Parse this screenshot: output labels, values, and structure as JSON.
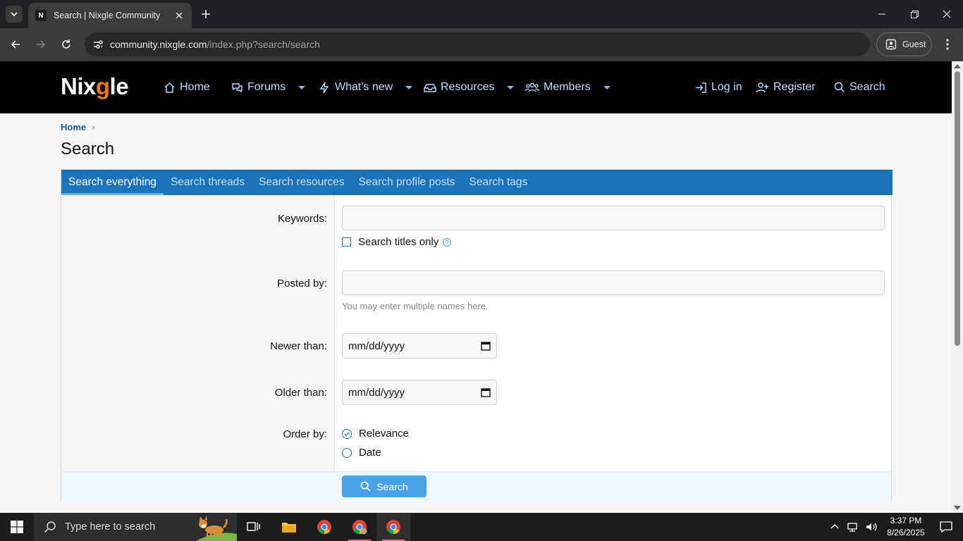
{
  "browser": {
    "tab_title": "Search | Nixgle Community",
    "favicon_letter": "N",
    "url_host": "community.nixgle.com",
    "url_path": "/index.php?search/search",
    "profile_label": "Guest"
  },
  "site": {
    "logo_main": "Nix",
    "logo_accent": "g",
    "logo_end": "le",
    "nav": {
      "home": "Home",
      "forums": "Forums",
      "whats_new": "What's new",
      "resources": "Resources",
      "members": "Members",
      "login": "Log in",
      "register": "Register",
      "search": "Search"
    }
  },
  "breadcrumb": {
    "home": "Home"
  },
  "page_title": "Search",
  "tabs": {
    "everything": "Search everything",
    "threads": "Search threads",
    "resources": "Search resources",
    "profile_posts": "Search profile posts",
    "tags": "Search tags"
  },
  "form": {
    "keywords_label": "Keywords:",
    "keywords_value": "",
    "titles_only_label": "Search titles only",
    "posted_by_label": "Posted by:",
    "posted_by_value": "",
    "posted_by_hint": "You may enter multiple names here.",
    "newer_than_label": "Newer than:",
    "newer_than_value": "mm/dd/yyyy",
    "older_than_label": "Older than:",
    "older_than_value": "mm/dd/yyyy",
    "order_by_label": "Order by:",
    "order_relevance": "Relevance",
    "order_date": "Date",
    "order_selected": "Relevance",
    "submit_label": "Search"
  },
  "taskbar": {
    "search_placeholder": "Type here to search",
    "time": "3:37 PM",
    "date": "8/26/2025"
  },
  "colors": {
    "header_bg": "#000000",
    "tabbar_bg": "#1a73b8",
    "accent": "#4aa3e8",
    "logo_accent": "#f07a12"
  }
}
